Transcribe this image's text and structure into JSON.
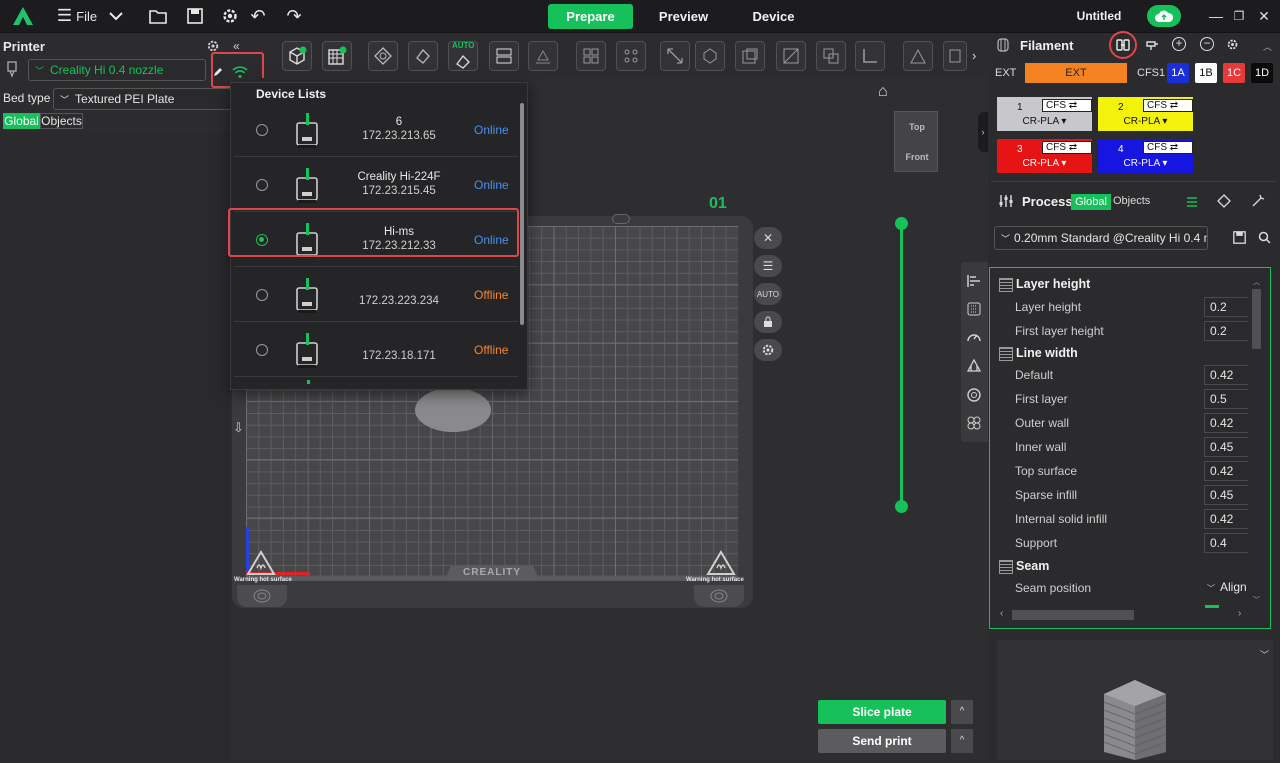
{
  "topbar": {
    "file_label": "File",
    "tabs": [
      {
        "label": "Prepare",
        "active": true
      },
      {
        "label": "Preview",
        "active": false
      },
      {
        "label": "Device",
        "active": false
      }
    ],
    "project_title": "Untitled"
  },
  "printer_panel": {
    "title": "Printer",
    "printer_value": "Creality Hi 0.4 nozzle",
    "bed_type_label": "Bed type",
    "bed_type_value": "Textured PEI Plate",
    "scope_tabs": [
      "Global",
      "Objects"
    ]
  },
  "toolbar": {
    "auto_badge": "AUTO"
  },
  "device_list": {
    "title": "Device Lists",
    "devices": [
      {
        "name": "6",
        "ip": "172.23.213.65",
        "status": "Online",
        "selected": false
      },
      {
        "name": "Creality Hi-224F",
        "ip": "172.23.215.45",
        "status": "Online",
        "selected": false
      },
      {
        "name": "Hi-ms",
        "ip": "172.23.212.33",
        "status": "Online",
        "selected": true
      },
      {
        "name": "",
        "ip": "172.23.223.234",
        "status": "Offline",
        "selected": false
      },
      {
        "name": "",
        "ip": "172.23.18.171",
        "status": "Offline",
        "selected": false
      }
    ],
    "colors": {
      "online": "#4a8ff0",
      "offline": "#f0872a"
    }
  },
  "scene": {
    "plate_number": "01",
    "view_cube": {
      "top": "Top",
      "front": "Front"
    },
    "bed_brand": "CREALITY",
    "warning_left": "Warning hot surface",
    "warning_right": "Warning hot surface"
  },
  "filament": {
    "title": "Filament",
    "ext_label": "EXT",
    "ext_button": "EXT",
    "cfs_label": "CFS1",
    "cfs_tabs": [
      {
        "label": "1A",
        "bg": "#1b2fd6",
        "fg": "#ffffff"
      },
      {
        "label": "1B",
        "bg": "#ffffff",
        "fg": "#111111"
      },
      {
        "label": "1C",
        "bg": "#e63a3a",
        "fg": "#ffffff"
      },
      {
        "label": "1D",
        "bg": "#0a0a0a",
        "fg": "#ffffff"
      }
    ],
    "slots": [
      {
        "num": "1",
        "cfs": "CFS ⇄",
        "material": "CR-PLA ▾",
        "bg": "#c8c8cc",
        "fg": "#111111"
      },
      {
        "num": "2",
        "cfs": "CFS ⇄",
        "material": "CR-PLA ▾",
        "bg": "#f2f20a",
        "fg": "#111111"
      },
      {
        "num": "3",
        "cfs": "CFS ⇄",
        "material": "CR-PLA ▾",
        "bg": "#e61414",
        "fg": "#ffffff"
      },
      {
        "num": "4",
        "cfs": "CFS ⇄",
        "material": "CR-PLA ▾",
        "bg": "#1616e0",
        "fg": "#ffffff"
      }
    ],
    "ext_color": "#f58220"
  },
  "process": {
    "title": "Process",
    "tab_global": "Global",
    "tab_objects": "Objects",
    "profile": "0.20mm Standard @Creality Hi 0.4 n...",
    "groups": [
      {
        "title": "Layer height",
        "items": [
          {
            "label": "Layer height",
            "value": "0.2"
          },
          {
            "label": "First layer height",
            "value": "0.2"
          }
        ]
      },
      {
        "title": "Line width",
        "items": [
          {
            "label": "Default",
            "value": "0.42"
          },
          {
            "label": "First layer",
            "value": "0.5"
          },
          {
            "label": "Outer wall",
            "value": "0.42"
          },
          {
            "label": "Inner wall",
            "value": "0.45"
          },
          {
            "label": "Top surface",
            "value": "0.42"
          },
          {
            "label": "Sparse infill",
            "value": "0.45"
          },
          {
            "label": "Internal solid infill",
            "value": "0.42"
          },
          {
            "label": "Support",
            "value": "0.4"
          }
        ]
      },
      {
        "title": "Seam",
        "items": [
          {
            "label": "Seam position",
            "value": "Align"
          }
        ]
      }
    ]
  },
  "actions": {
    "slice": "Slice plate",
    "send": "Send print"
  },
  "colors": {
    "accent": "#16c05a",
    "highlight": "#e0454b"
  }
}
